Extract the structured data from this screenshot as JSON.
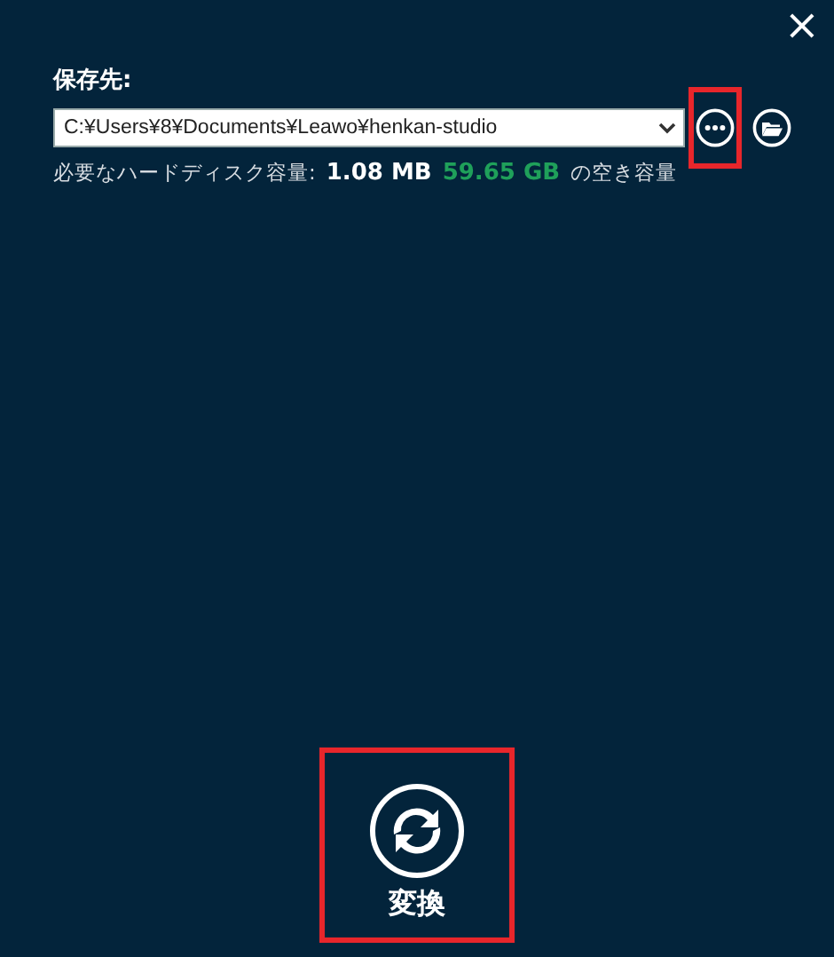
{
  "close_button": {
    "label": "×"
  },
  "destination": {
    "label": "保存先:",
    "path": "C:¥Users¥8¥Documents¥Leawo¥henkan-studio",
    "browse_highlighted": true
  },
  "disk_info": {
    "label": "必要なハードディスク容量:",
    "required": "1.08 MB",
    "free": "59.65 GB",
    "suffix": "の空き容量"
  },
  "convert_button": {
    "label": "変換",
    "highlighted": true
  }
}
